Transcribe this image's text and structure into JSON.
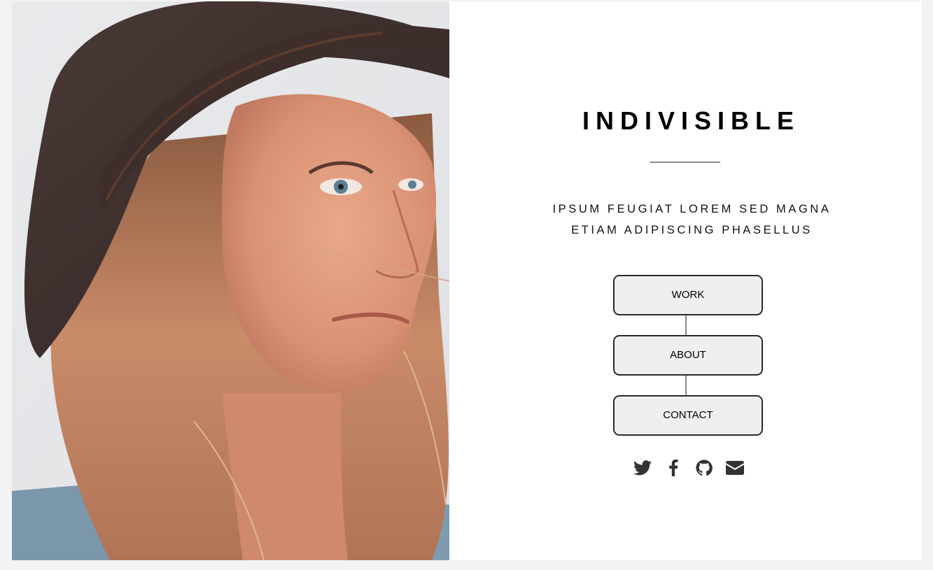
{
  "site": {
    "title": "INDIVISIBLE",
    "tagline_line1": "IPSUM FEUGIAT LOREM SED MAGNA",
    "tagline_line2": "ETIAM ADIPISCING PHASELLUS"
  },
  "nav": {
    "items": [
      {
        "label": "WORK"
      },
      {
        "label": "ABOUT"
      },
      {
        "label": "CONTACT"
      }
    ]
  },
  "social": {
    "icons": [
      "twitter-icon",
      "facebook-icon",
      "github-icon",
      "envelope-icon"
    ]
  },
  "colors": {
    "page_background": "#f3f3f3",
    "panel_background": "#ffffff",
    "button_fill": "#efefef",
    "button_border": "#2a2a2a",
    "divider": "#8a8a8a",
    "icon": "#333333"
  },
  "portrait": {
    "subject": "woman-in-hat-photo"
  }
}
